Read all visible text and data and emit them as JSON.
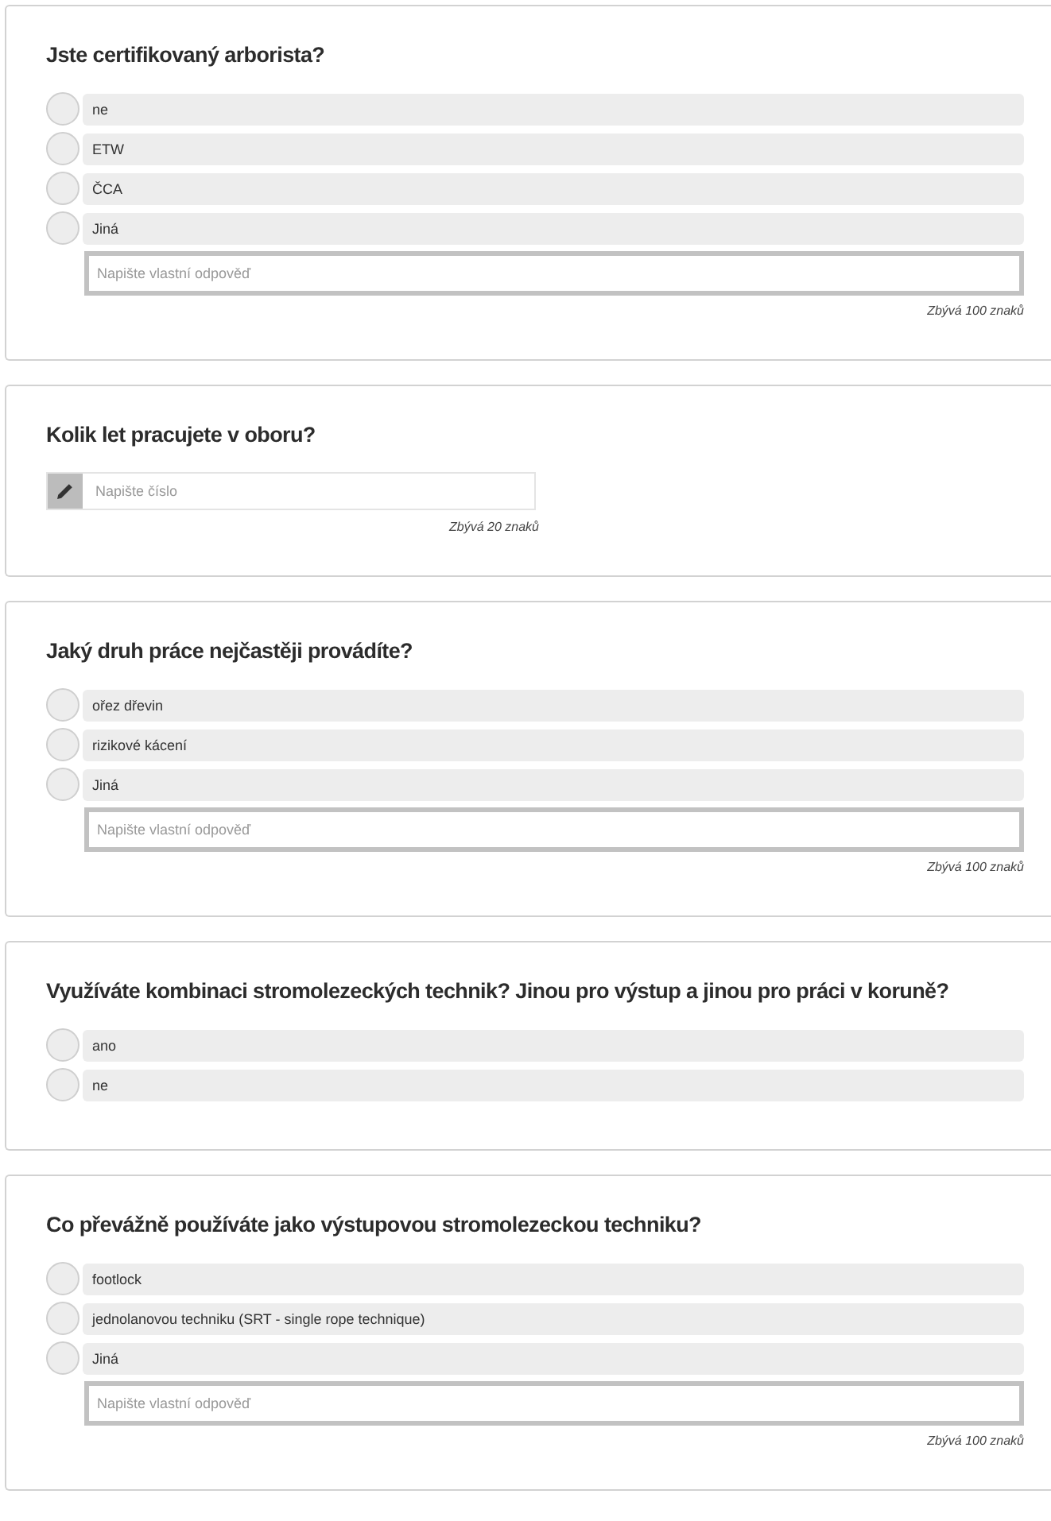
{
  "questions": [
    {
      "kind": "choice",
      "title": "Jste certifikovaný arborista?",
      "options": [
        {
          "label": "ne",
          "selected": false
        },
        {
          "label": "ETW",
          "selected": false
        },
        {
          "label": "ČCA",
          "selected": false
        },
        {
          "label": "Jiná",
          "selected": false
        }
      ],
      "other_field": {
        "placeholder": "Napište vlastní odpověď"
      },
      "counter": "Zbývá 100 znaků"
    },
    {
      "kind": "number",
      "title": "Kolik let pracujete v oboru?",
      "field": {
        "placeholder": "Napište číslo"
      },
      "counter": "Zbývá 20 znaků"
    },
    {
      "kind": "choice",
      "title": "Jaký druh práce nejčastěji provádíte?",
      "options": [
        {
          "label": "ořez dřevin",
          "selected": false
        },
        {
          "label": "rizikové kácení",
          "selected": false
        },
        {
          "label": "Jiná",
          "selected": false
        }
      ],
      "other_field": {
        "placeholder": "Napište vlastní odpověď"
      },
      "counter": "Zbývá 100 znaků"
    },
    {
      "kind": "choice",
      "title": "Využíváte kombinaci stromolezeckých technik? Jinou pro výstup a jinou pro práci v koruně?",
      "options": [
        {
          "label": "ano",
          "selected": false
        },
        {
          "label": "ne",
          "selected": false
        }
      ]
    },
    {
      "kind": "choice",
      "title": "Co převážně používáte jako výstupovou stromolezeckou techniku?",
      "options": [
        {
          "label": "footlock",
          "selected": false
        },
        {
          "label": "jednolanovou techniku (SRT - single rope technique)",
          "selected": false
        },
        {
          "label": "Jiná",
          "selected": false
        }
      ],
      "other_field": {
        "placeholder": "Napište vlastní odpověď"
      },
      "counter": "Zbývá 100 znaků"
    }
  ]
}
